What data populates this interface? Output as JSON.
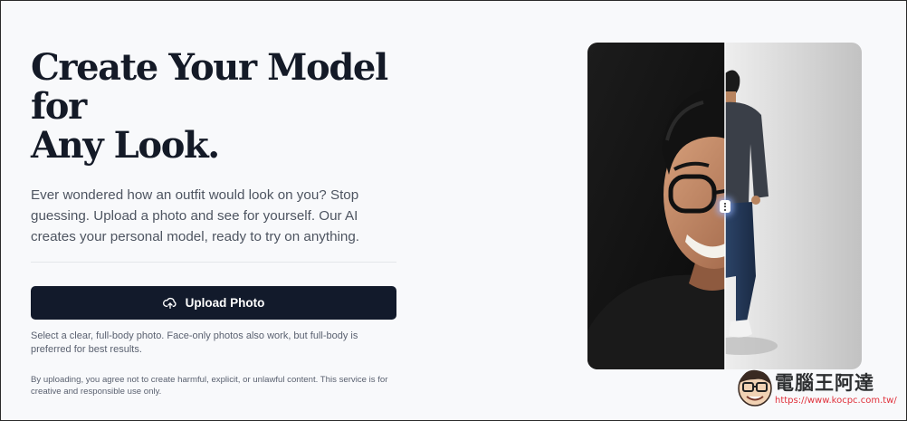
{
  "hero": {
    "title_line1": "Create Your Model for",
    "title_line2": "Any Look.",
    "lead": "Ever wondered how an outfit would look on you? Stop guessing. Upload a photo and see for yourself. Our AI creates your personal model, ready to try on anything."
  },
  "upload": {
    "button_label": "Upload Photo",
    "icon": "cloud-upload-icon",
    "hint": "Select a clear, full-body photo. Face-only photos also work, but full-body is preferred for best results.",
    "terms": "By uploading, you agree not to create harmful, explicit, or unlawful content. This service is for creative and responsible use only."
  },
  "comparison": {
    "slider_position_fraction": 0.5,
    "handle_icon": "vertical-dots-icon"
  },
  "watermark": {
    "title": "電腦王阿達",
    "url": "https://www.kocpc.com.tw/"
  },
  "colors": {
    "button_bg": "#121a2b",
    "heading": "#141a27",
    "body_text": "#4e5561",
    "page_bg": "#f8f9fb"
  }
}
